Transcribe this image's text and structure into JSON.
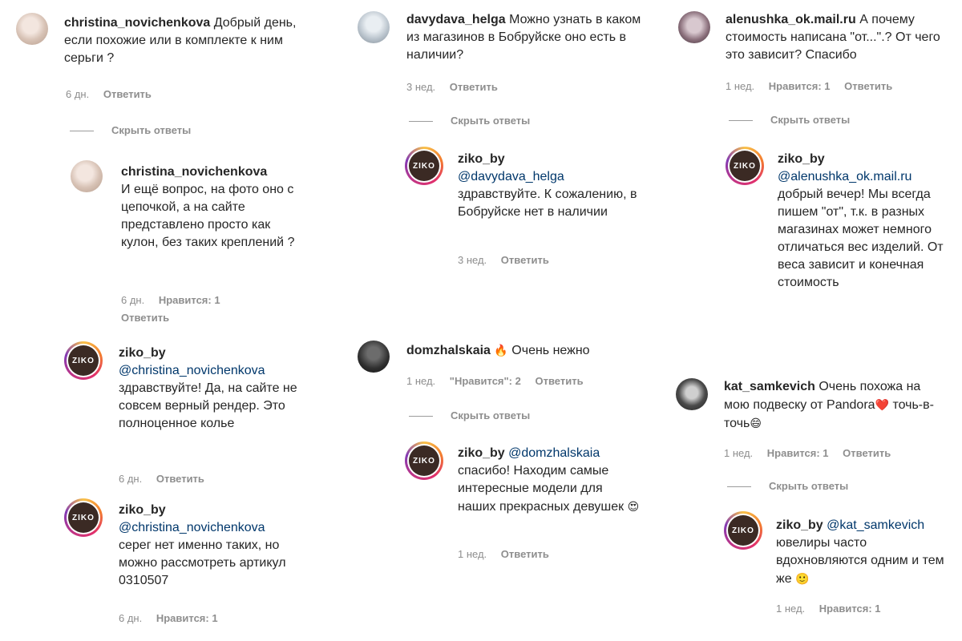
{
  "comments": [
    {
      "id": "c1",
      "user": "christina_novichenkova",
      "text": "Добрый день, если похожие или в комплекте к ним серьги ?",
      "time": "6 дн.",
      "reply": "Ответить",
      "hide": "Скрыть ответы"
    },
    {
      "id": "c1r1",
      "user": "christina_novichenkova",
      "text": "И ещё вопрос, на фото оно с цепочкой, а на сайте представлено просто как кулон, без таких креплений ?",
      "time": "6 дн.",
      "likes": "Нравится: 1",
      "reply": "Ответить"
    },
    {
      "id": "c1r2",
      "user": "ziko_by",
      "mention": "@christina_novichenkova",
      "text": "здравствуйте! Да, на сайте не совсем верный рендер. Это полноценное колье",
      "time": "6 дн.",
      "reply": "Ответить"
    },
    {
      "id": "c1r3",
      "user": "ziko_by",
      "mention": "@christina_novichenkova",
      "text": "серег нет именно таких, но можно рассмотреть артикул 0310507",
      "time": "6 дн.",
      "likes": "Нравится: 1"
    },
    {
      "id": "c2",
      "user": "davydava_helga",
      "text": "Можно узнать в каком из магазинов в Бобруйске оно есть в наличии?",
      "time": "3 нед.",
      "reply": "Ответить",
      "hide": "Скрыть ответы"
    },
    {
      "id": "c2r1",
      "user": "ziko_by",
      "mention": "@davydava_helga",
      "text": "здравствуйте. К сожалению, в Бобруйске нет в наличии",
      "time": "3 нед.",
      "reply": "Ответить"
    },
    {
      "id": "c3",
      "user": "domzhalskaia",
      "emoji": "🔥",
      "text": "Очень нежно",
      "time": "1 нед.",
      "likes": "\"Нравится\": 2",
      "reply": "Ответить",
      "hide": "Скрыть ответы"
    },
    {
      "id": "c3r1",
      "user": "ziko_by",
      "mention": "@domzhalskaia",
      "text": "спасибо! Находим самые интересные модели для наших прекрасных девушек",
      "emoji": "😍",
      "time": "1 нед.",
      "reply": "Ответить"
    },
    {
      "id": "c4",
      "user": "alenushka_ok.mail.ru",
      "text": "А почему стоимость написана \"от...\".? От чего это зависит? Спасибо",
      "time": "1 нед.",
      "likes": "Нравится: 1",
      "reply": "Ответить",
      "hide": "Скрыть ответы"
    },
    {
      "id": "c4r1",
      "user": "ziko_by",
      "mention": "@alenushka_ok.mail.ru",
      "text": "добрый вечер! Мы всегда пишем \"от\", т.к. в разных магазинах может немного отличаться вес изделий. От веса зависит и конечная стоимость"
    },
    {
      "id": "c5",
      "user": "kat_samkevich",
      "text": "Очень похожа на мою подвеску от Pandora",
      "emoji": "❤️",
      "text2": "точь-в-точь",
      "emoji2": "😄",
      "time": "1 нед.",
      "likes": "Нравится: 1",
      "reply": "Ответить",
      "hide": "Скрыть ответы"
    },
    {
      "id": "c5r1",
      "user": "ziko_by",
      "mention": "@kat_samkevich",
      "text": "ювелиры часто вдохновляются одним и тем же",
      "emoji": "🙂",
      "time": "1 нед.",
      "likes": "Нравится: 1"
    }
  ],
  "brand_logo_text": "ZIKO"
}
